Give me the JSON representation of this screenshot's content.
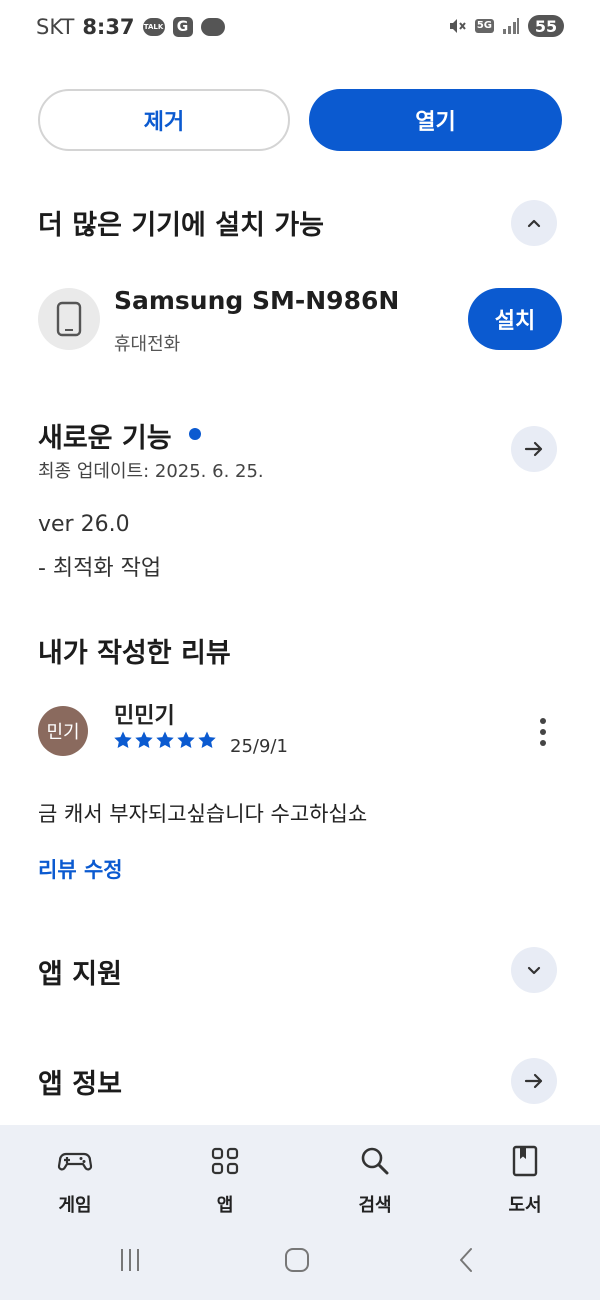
{
  "status_bar": {
    "carrier": "SKT",
    "time": "8:37",
    "talk_badge": "TALK",
    "g_badge": "G",
    "network": "5G",
    "battery": "55"
  },
  "actions": {
    "remove_label": "제거",
    "open_label": "열기"
  },
  "devices_section": {
    "title": "더 많은 기기에 설치 가능",
    "device_name": "Samsung SM-N986N",
    "device_type": "휴대전화",
    "install_label": "설치"
  },
  "whats_new": {
    "title": "새로운 기능",
    "updated": "최종 업데이트: 2025. 6. 25.",
    "version": "ver 26.0",
    "notes": "- 최적화 작업"
  },
  "my_review": {
    "title": "내가 작성한 리뷰",
    "avatar_text": "민기",
    "reviewer": "민민기",
    "rating": 5,
    "date": "25/9/1",
    "text": "금 캐서 부자되고싶습니다 수고하십쇼",
    "edit_label": "리뷰 수정"
  },
  "app_support": {
    "title": "앱 지원"
  },
  "app_info": {
    "title": "앱 정보"
  },
  "bottom_nav": {
    "items": [
      {
        "label": "게임",
        "icon": "gamepad-icon"
      },
      {
        "label": "앱",
        "icon": "apps-grid-icon"
      },
      {
        "label": "검색",
        "icon": "search-icon"
      },
      {
        "label": "도서",
        "icon": "book-icon"
      }
    ]
  },
  "colors": {
    "accent": "#0b5ad0",
    "nav_bg": "#edf0f6",
    "round_btn_bg": "#e8ecf5",
    "avatar_bg": "#8a6a5e"
  }
}
